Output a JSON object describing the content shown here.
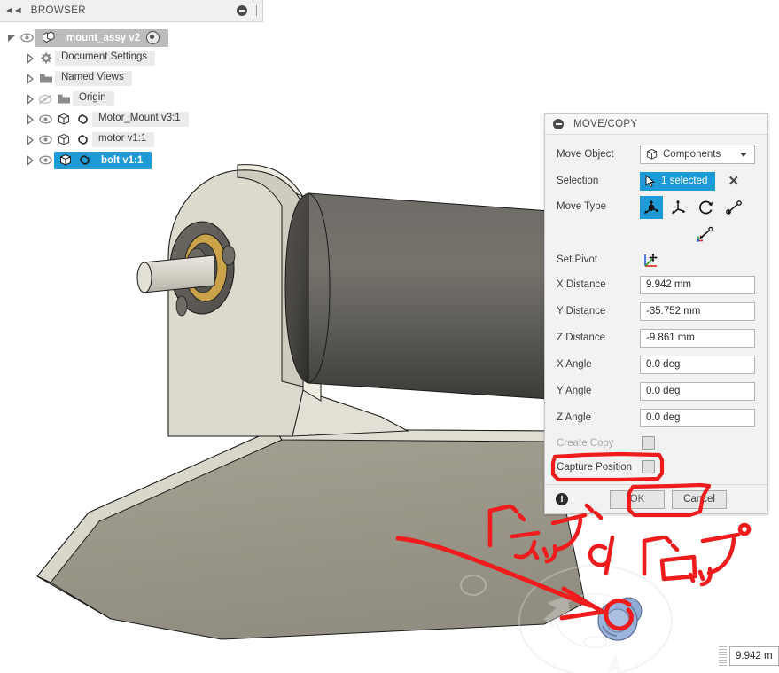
{
  "browser": {
    "title": "BROWSER",
    "collapse_icon": "collapse-left-icon",
    "minimize_icon": "minimize-icon",
    "grip_icon": "grip-icon",
    "items": [
      {
        "label": "mount_assy v2",
        "kind": "root",
        "icon": "assembly-icon",
        "has_eye": true,
        "has_arrow": true,
        "arrow": "open",
        "has_radio": true,
        "selected": false,
        "depth": 0
      },
      {
        "label": "Document Settings",
        "kind": "folder",
        "icon": "gear-icon",
        "has_eye": false,
        "has_arrow": true,
        "arrow": "closed",
        "has_radio": false,
        "selected": false,
        "depth": 1
      },
      {
        "label": "Named Views",
        "kind": "folder",
        "icon": "folder-icon",
        "has_eye": false,
        "has_arrow": true,
        "arrow": "closed",
        "has_radio": false,
        "selected": false,
        "depth": 1
      },
      {
        "label": "Origin",
        "kind": "folder",
        "icon": "folder-icon",
        "has_eye": true,
        "eye_off": true,
        "has_arrow": true,
        "arrow": "closed",
        "has_radio": false,
        "selected": false,
        "depth": 1
      },
      {
        "label": "Motor_Mount v3:1",
        "kind": "component",
        "icon": "component-icon",
        "has_eye": true,
        "has_arrow": true,
        "arrow": "closed",
        "has_link": true,
        "has_radio": false,
        "selected": false,
        "depth": 1
      },
      {
        "label": "motor v1:1",
        "kind": "component",
        "icon": "component-icon",
        "has_eye": true,
        "has_arrow": true,
        "arrow": "closed",
        "has_link": true,
        "has_radio": false,
        "selected": false,
        "depth": 1
      },
      {
        "label": "bolt v1:1",
        "kind": "component",
        "icon": "component-icon",
        "has_eye": true,
        "has_arrow": true,
        "arrow": "closed",
        "has_link": true,
        "has_radio": false,
        "selected": true,
        "depth": 1
      }
    ]
  },
  "movecopy": {
    "title": "MOVE/COPY",
    "collapse_icon": "minimize-icon",
    "move_object": {
      "label": "Move Object",
      "value": "Components",
      "icon": "component-icon",
      "caret_icon": "chevron-down-icon"
    },
    "selection": {
      "label": "Selection",
      "value": "1 selected",
      "cursor_icon": "select-cursor-icon",
      "clear_icon": "close-x-icon"
    },
    "move_type": {
      "label": "Move Type",
      "options": [
        {
          "name": "free-move-icon",
          "active": true
        },
        {
          "name": "translate-icon",
          "active": false
        },
        {
          "name": "rotate-icon",
          "active": false
        },
        {
          "name": "point-to-point-icon",
          "active": false
        },
        {
          "name": "point-to-position-icon",
          "active": false
        }
      ]
    },
    "set_pivot": {
      "label": "Set Pivot",
      "icon": "set-pivot-icon"
    },
    "fields": [
      {
        "label": "X Distance",
        "value": "9.942 mm"
      },
      {
        "label": "Y Distance",
        "value": "-35.752 mm"
      },
      {
        "label": "Z Distance",
        "value": "-9.861 mm"
      },
      {
        "label": "X Angle",
        "value": "0.0 deg"
      },
      {
        "label": "Y Angle",
        "value": "0.0 deg"
      },
      {
        "label": "Z Angle",
        "value": "0.0 deg"
      }
    ],
    "create_copy": {
      "label": "Create Copy",
      "checked": false,
      "disabled": true
    },
    "capture_position": {
      "label": "Capture Position",
      "checked": false,
      "disabled": false
    },
    "footer": {
      "info_icon": "info-icon",
      "info_glyph": "i",
      "ok_label": "OK",
      "cancel_label": "Cancel"
    }
  },
  "viewport": {
    "value_field": "9.942 m",
    "grip_icon": "drag-grip-icon",
    "nav_widget_icon": "orbit-widget-icon"
  },
  "annotations": {
    "color": "#ee1c1c",
    "text_drag": "ドラッグ",
    "text_amp": "&",
    "text_drop": "ドロップ",
    "highlight_capture_position": "capture-position-highlight",
    "highlight_ok": "ok-button-highlight",
    "arrow": "drag-drop-arrow",
    "target_circle": "orbit-target-circle"
  },
  "colors": {
    "accent_blue": "#1e9ad6",
    "annotation_red": "#ee1c1c",
    "panel_bg": "#f2f2f2",
    "part_light": "#dedbd0",
    "part_base": "#9d998c",
    "part_dark": "#565451",
    "brass": "#c9a24a"
  }
}
